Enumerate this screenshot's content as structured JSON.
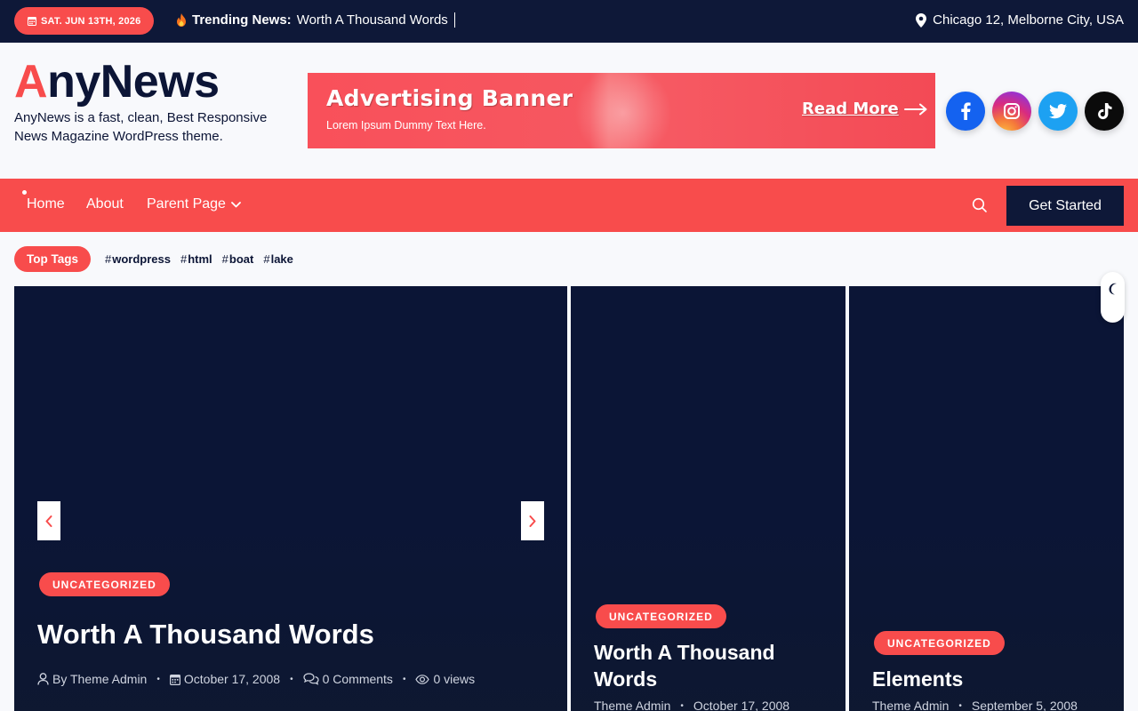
{
  "topbar": {
    "date": "SAT. JUN 13TH, 2026",
    "trending_label": "Trending News:",
    "trending_title": "Worth A Thousand Words",
    "location": "Chicago 12, Melborne City, USA"
  },
  "brand": {
    "logo_first": "A",
    "logo_rest": "nyNews",
    "tagline": "AnyNews is a fast, clean, Best Responsive News Magazine WordPress theme."
  },
  "banner": {
    "title": "Advertising Banner",
    "subtitle": "Lorem Ipsum Dummy Text Here.",
    "cta": "Read More"
  },
  "socials": [
    "facebook-icon",
    "instagram-icon",
    "twitter-icon",
    "tiktok-icon"
  ],
  "nav": {
    "items": [
      "Home",
      "About",
      "Parent Page"
    ],
    "cta": "Get Started"
  },
  "tags": {
    "label": "Top Tags",
    "items": [
      "wordpress",
      "html",
      "boat",
      "lake"
    ]
  },
  "slides": [
    {
      "category": "UNCATEGORIZED",
      "title": "Worth A Thousand Words",
      "author": "By Theme Admin",
      "date": "October 17, 2008",
      "comments": "0 Comments",
      "views": "0 views"
    },
    {
      "category": "UNCATEGORIZED",
      "title": "Worth A Thousand Words",
      "author": "Theme Admin",
      "date": "October 17, 2008"
    },
    {
      "category": "UNCATEGORIZED",
      "title": "Elements",
      "author": "Theme Admin",
      "date": "September 5, 2008"
    }
  ],
  "colors": {
    "accent": "#f84c4c",
    "navy": "#0e1838",
    "card": "#0b1536"
  }
}
